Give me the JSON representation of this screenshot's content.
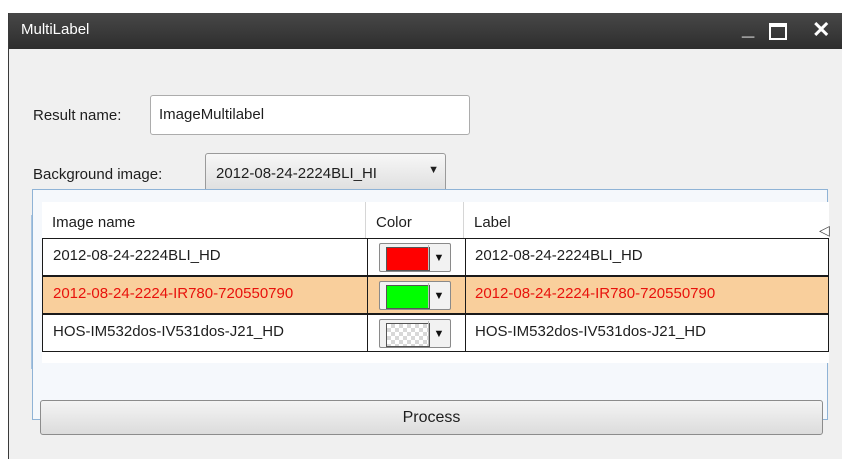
{
  "window": {
    "title": "MultiLabel"
  },
  "form": {
    "result_name_label": "Result name:",
    "result_name_value": "ImageMultilabel",
    "background_label": "Background image:",
    "background_value": "2012-08-24-2224BLI_HI"
  },
  "grid": {
    "columns": [
      "Image name",
      "Color",
      "Label"
    ],
    "rows": [
      {
        "image_name": "2012-08-24-2224BLI_HD",
        "color": "#ff0000",
        "label": "2012-08-24-2224BLI_HD",
        "selected": false
      },
      {
        "image_name": "2012-08-24-2224-IR780-720550790",
        "color": "#00ff00",
        "label": "2012-08-24-2224-IR780-720550790",
        "selected": true
      },
      {
        "image_name": "HOS-IM532dos-IV531dos-J21_HD",
        "color": "transparent",
        "label": "HOS-IM532dos-IV531dos-J21_HD",
        "selected": false
      }
    ]
  },
  "actions": {
    "process_label": "Process"
  },
  "colors": {
    "titlebar": "#3a3a3a",
    "selected_row": "#f9cf9c",
    "selected_text": "#e8120c",
    "grid_border": "#8fb3d6"
  },
  "icons": {
    "minimize": "minimize-icon",
    "maximize": "maximize-icon",
    "close": "close-icon",
    "dropdown": "chevron-down-icon"
  }
}
